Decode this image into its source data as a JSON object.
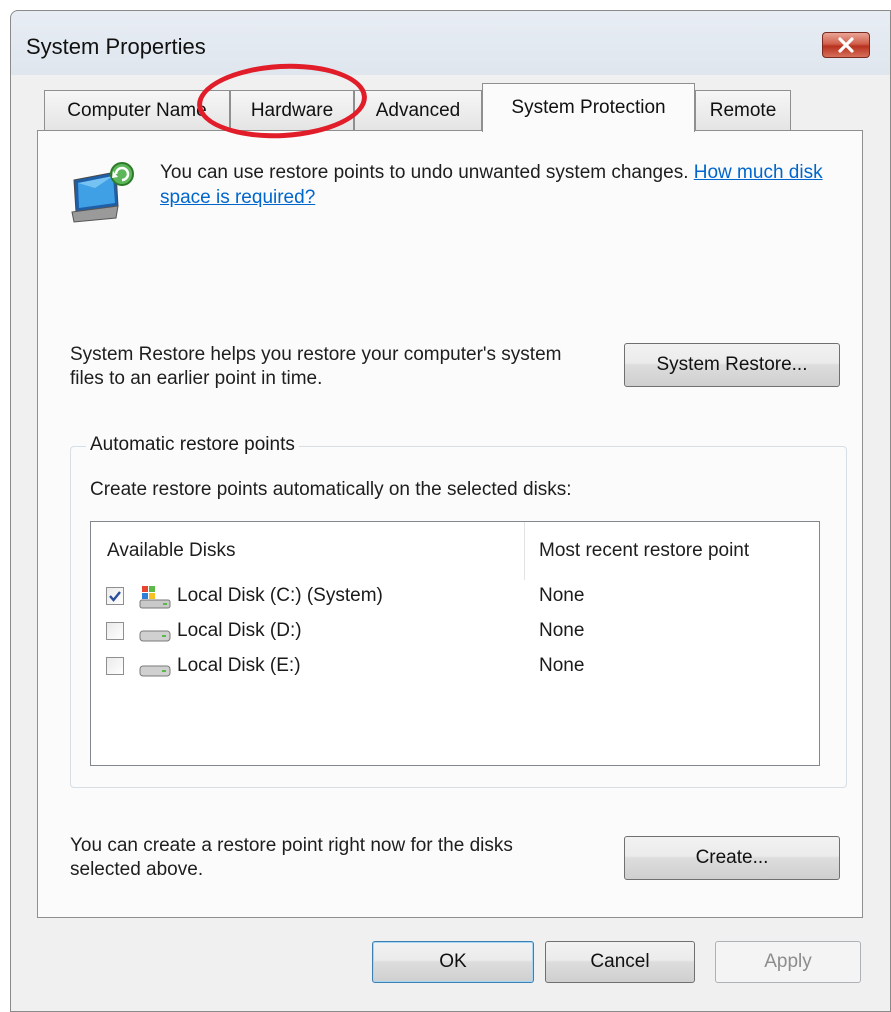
{
  "window": {
    "title": "System Properties"
  },
  "tabs": [
    {
      "label": "Computer Name"
    },
    {
      "label": "Hardware"
    },
    {
      "label": "Advanced"
    },
    {
      "label": "System Protection"
    },
    {
      "label": "Remote"
    }
  ],
  "intro": {
    "text": "You can use restore points to undo unwanted system changes. ",
    "link": "How much disk space is required?"
  },
  "restore": {
    "description": "System Restore helps you restore your computer's system files to an earlier point in time.",
    "button_label": "System Restore..."
  },
  "auto_points": {
    "group_label": "Automatic restore points",
    "instruction": "Create restore points automatically on the selected disks:",
    "columns": [
      "Available Disks",
      "Most recent restore point"
    ],
    "disks": [
      {
        "name": "Local Disk (C:) (System)",
        "recent": "None",
        "checked": true
      },
      {
        "name": "Local Disk (D:)",
        "recent": "None",
        "checked": false
      },
      {
        "name": "Local Disk (E:)",
        "recent": "None",
        "checked": false
      }
    ]
  },
  "create": {
    "description": "You can create a restore point right now for the disks selected above.",
    "button_label": "Create..."
  },
  "footer": {
    "ok_label": "OK",
    "cancel_label": "Cancel",
    "apply_label": "Apply"
  },
  "colors": {
    "annotation": "#e11d2a",
    "link": "#0066cc",
    "close": "#c9452f"
  }
}
